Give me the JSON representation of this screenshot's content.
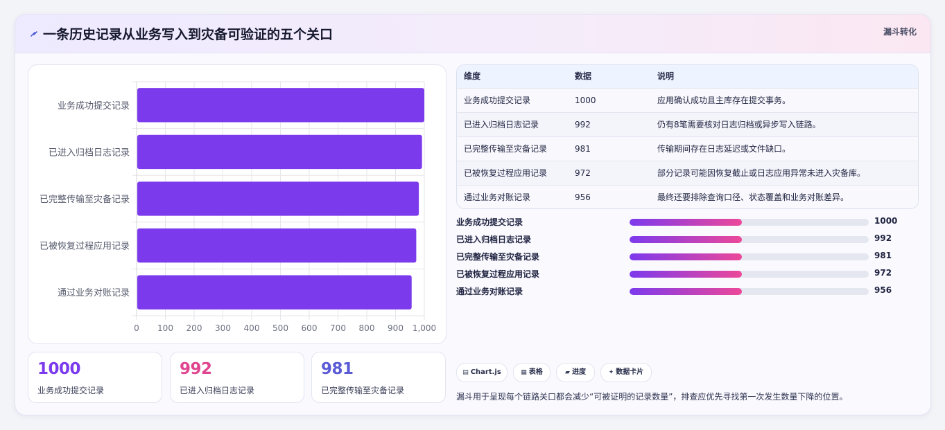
{
  "header": {
    "title": "一条历史记录从业务写入到灾备可验证的五个关口",
    "tag": "漏斗转化"
  },
  "colors": {
    "bar": "#7c3aed",
    "accent_purple": "#7c3aed",
    "accent_pink": "#e0458f",
    "accent_indigo": "#5b5bd6",
    "gradient_start": "#7c3aed",
    "gradient_end": "#ec4899"
  },
  "chart_data": {
    "type": "bar",
    "orientation": "horizontal",
    "categories": [
      "业务成功提交记录",
      "已进入归档日志记录",
      "已完整传输至灾备记录",
      "已被恢复过程应用记录",
      "通过业务对账记录"
    ],
    "values": [
      1000,
      992,
      981,
      972,
      956
    ],
    "xlim": [
      0,
      1000
    ],
    "xticks": [
      "0",
      "100",
      "200",
      "300",
      "400",
      "500",
      "600",
      "700",
      "800",
      "900",
      "1,000"
    ],
    "grid": true,
    "legend": "none"
  },
  "stats": [
    {
      "value": "1000",
      "label": "业务成功提交记录",
      "color": "#7c3aed"
    },
    {
      "value": "992",
      "label": "已进入归档日志记录",
      "color": "#e0458f"
    },
    {
      "value": "981",
      "label": "已完整传输至灾备记录",
      "color": "#5b5bd6"
    }
  ],
  "table": {
    "headers": [
      "维度",
      "数据",
      "说明"
    ],
    "rows": [
      [
        "业务成功提交记录",
        "1000",
        "应用确认成功且主库存在提交事务。"
      ],
      [
        "已进入归档日志记录",
        "992",
        "仍有8笔需要核对日志归档或异步写入链路。"
      ],
      [
        "已完整传输至灾备记录",
        "981",
        "传输期间存在日志延迟或文件缺口。"
      ],
      [
        "已被恢复过程应用记录",
        "972",
        "部分记录可能因恢复截止或日志应用异常未进入灾备库。"
      ],
      [
        "通过业务对账记录",
        "956",
        "最终还要排除查询口径、状态覆盖和业务对账差异。"
      ]
    ]
  },
  "progress": {
    "items": [
      {
        "label": "业务成功提交记录",
        "value": "1000",
        "fill_percent": 47
      },
      {
        "label": "已进入归档日志记录",
        "value": "992",
        "fill_percent": 47
      },
      {
        "label": "已完整传输至灾备记录",
        "value": "981",
        "fill_percent": 47
      },
      {
        "label": "已被恢复过程应用记录",
        "value": "972",
        "fill_percent": 47
      },
      {
        "label": "通过业务对账记录",
        "value": "956",
        "fill_percent": 47
      }
    ]
  },
  "chips": [
    {
      "icon": "chart-icon",
      "glyph": "▤",
      "label": "Chart.js"
    },
    {
      "icon": "table-icon",
      "glyph": "▦",
      "label": "表格"
    },
    {
      "icon": "progress-icon",
      "glyph": "▰",
      "label": "进度"
    },
    {
      "icon": "sparkle-icon",
      "glyph": "✦",
      "label": "数据卡片"
    }
  ],
  "footnote": "漏斗用于呈现每个链路关口都会减少“可被证明的记录数量”，排查应优先寻找第一次发生数量下降的位置。"
}
